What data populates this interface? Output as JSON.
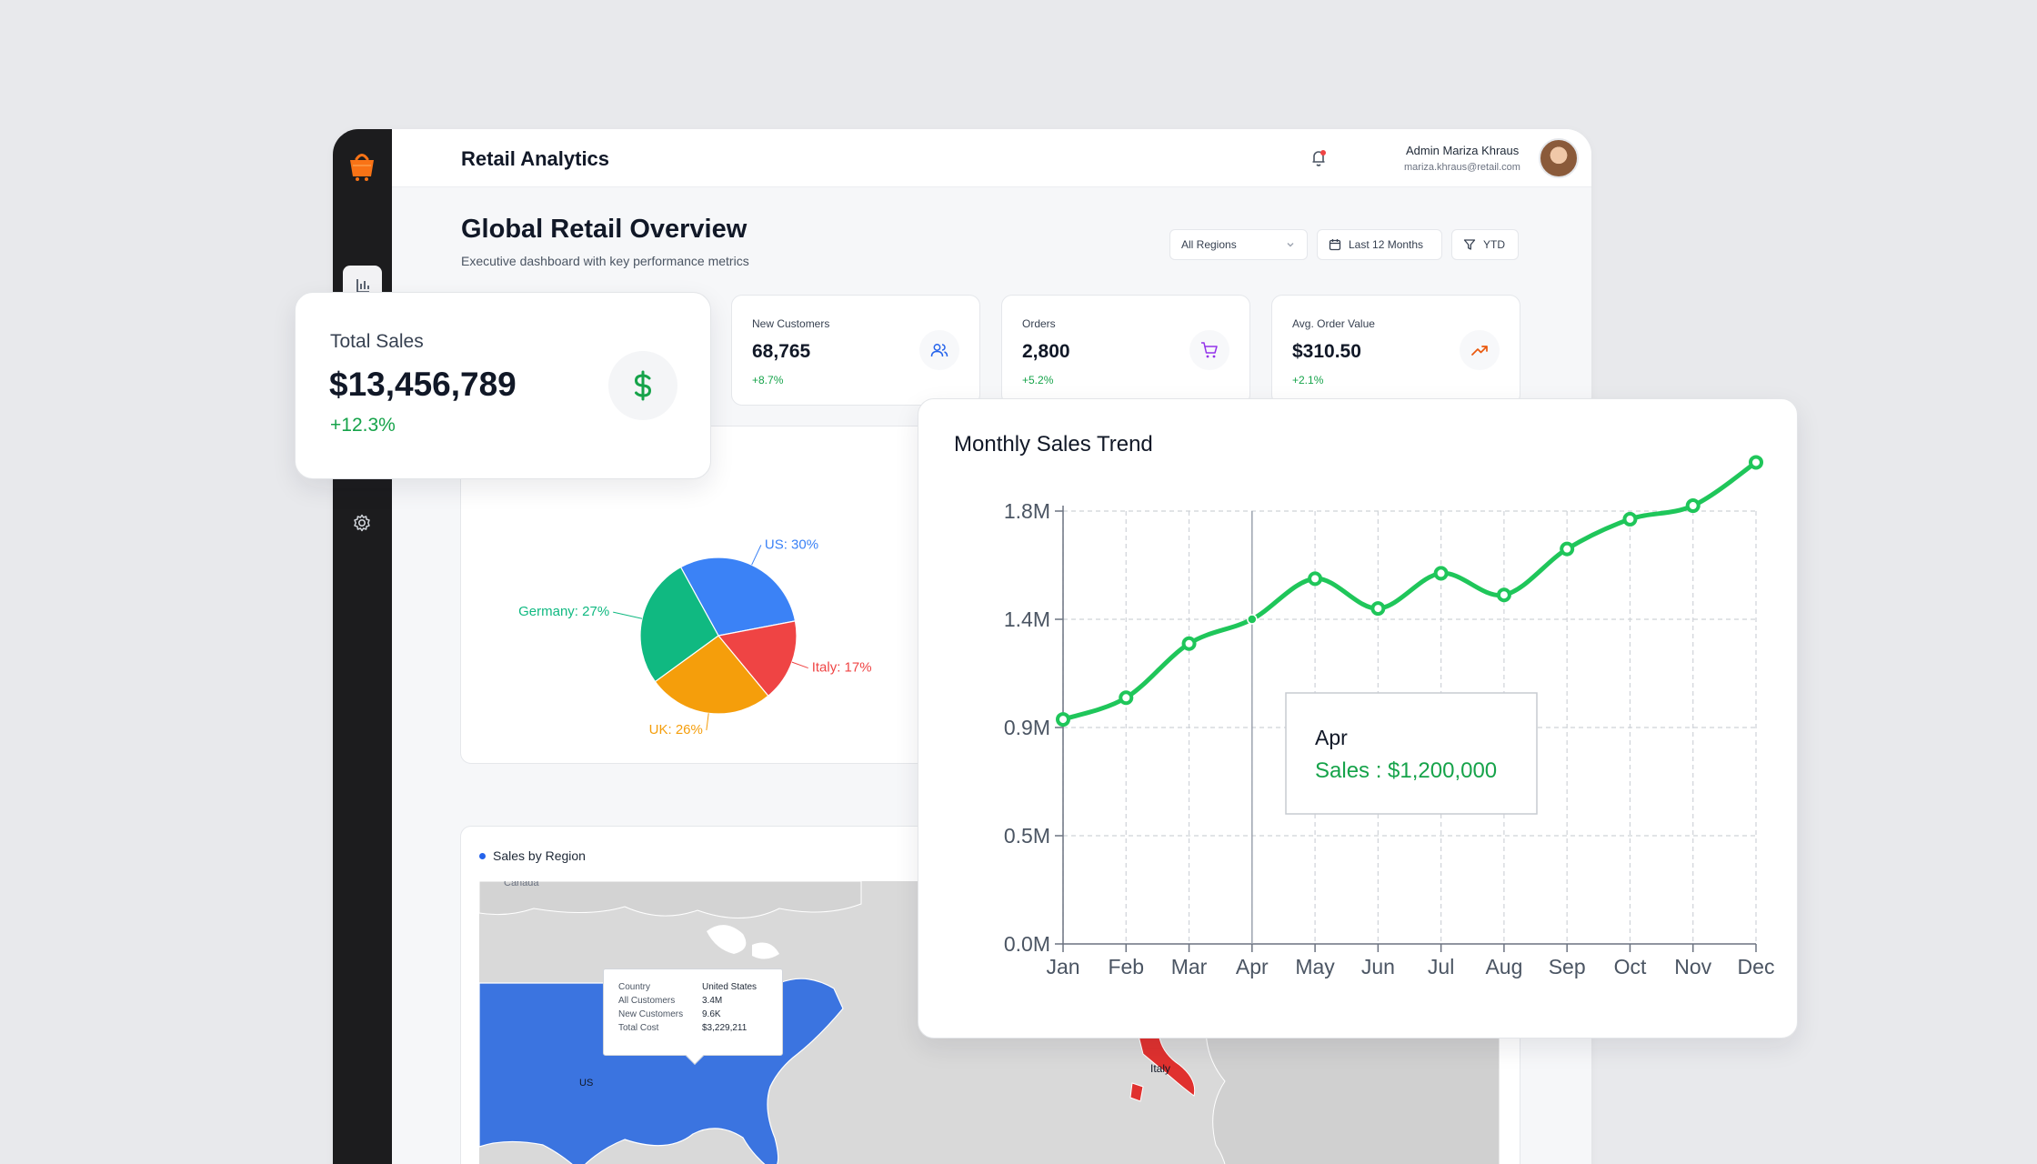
{
  "header": {
    "app_title": "Retail Analytics",
    "user_name": "Admin Mariza Khraus",
    "user_email": "mariza.khraus@retail.com"
  },
  "page": {
    "title": "Global Retail Overview",
    "subtitle": "Executive dashboard with key performance metrics"
  },
  "filters": {
    "region": "All Regions",
    "period": "Last 12 Months",
    "ytd": "YTD"
  },
  "kpis": [
    {
      "label": "New Customers",
      "value": "68,765",
      "change": "+8.7%",
      "icon": "users-icon",
      "color": "#2563eb"
    },
    {
      "label": "Orders",
      "value": "2,800",
      "change": "+5.2%",
      "icon": "cart-icon",
      "color": "#9333ea"
    },
    {
      "label": "Avg. Order Value",
      "value": "$310.50",
      "change": "+2.1%",
      "icon": "trending-up-icon",
      "color": "#ea580c"
    }
  ],
  "total_sales": {
    "label": "Total Sales",
    "value": "$13,456,789",
    "change": "+12.3%",
    "icon": "dollar-icon"
  },
  "map": {
    "legend": "Sales by Region",
    "labels": {
      "canada": "Canada",
      "us": "US",
      "italy": "Italy"
    },
    "tooltip": [
      {
        "key": "Country",
        "value": "United States"
      },
      {
        "key": "All Customers",
        "value": "3.4M"
      },
      {
        "key": "New Customers",
        "value": "9.6K"
      },
      {
        "key": "Total Cost",
        "value": "$3,229,211"
      }
    ]
  },
  "chart_data": [
    {
      "type": "pie",
      "slices": [
        {
          "label": "US: 30%",
          "name": "US",
          "value": 30,
          "color": "#3b82f6"
        },
        {
          "label": "Italy: 17%",
          "name": "Italy",
          "value": 17,
          "color": "#ef4444"
        },
        {
          "label": "UK: 26%",
          "name": "UK",
          "value": 26,
          "color": "#f59e0b"
        },
        {
          "label": "Germany: 27%",
          "name": "Germany",
          "value": 27,
          "color": "#10b981"
        }
      ]
    },
    {
      "type": "line",
      "title": "Monthly Sales Trend",
      "categories": [
        "Jan",
        "Feb",
        "Mar",
        "Apr",
        "May",
        "Jun",
        "Jul",
        "Aug",
        "Sep",
        "Oct",
        "Nov",
        "Dec"
      ],
      "series": [
        {
          "name": "Sales",
          "color": "#1fc65a",
          "values": [
            830000,
            910000,
            1110000,
            1200000,
            1350000,
            1240000,
            1370000,
            1290000,
            1460000,
            1570000,
            1620000,
            1780000
          ]
        }
      ],
      "yticks": [
        {
          "value": 0,
          "label": "0.0M"
        },
        {
          "value": 400000,
          "label": "0.5M"
        },
        {
          "value": 800000,
          "label": "0.9M"
        },
        {
          "value": 1200000,
          "label": "1.4M"
        },
        {
          "value": 1600000,
          "label": "1.8M"
        }
      ],
      "ylim": [
        0,
        1600000
      ],
      "grid": true,
      "tooltip": {
        "month": "Apr",
        "label": "Sales : $1,200,000"
      }
    }
  ]
}
